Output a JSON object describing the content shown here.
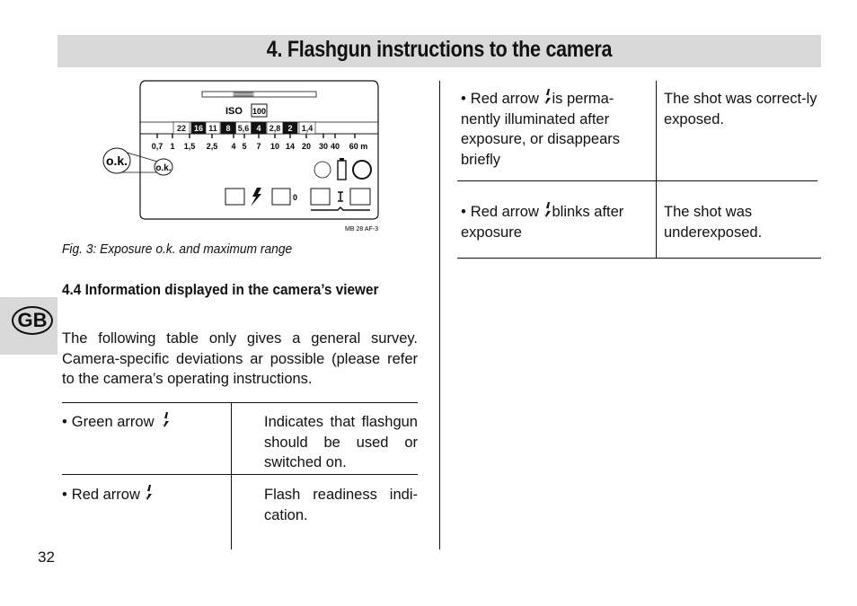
{
  "header": {
    "title": "4. Flashgun instructions to the camera"
  },
  "language_tab": {
    "label": "GB"
  },
  "figure": {
    "caption": "Fig. 3: Exposure o.k. and maximum range",
    "iso_label": "ISO",
    "iso_value": "100",
    "apertures": [
      {
        "value": "22",
        "inverted": false
      },
      {
        "value": "16",
        "inverted": true
      },
      {
        "value": "11",
        "inverted": false
      },
      {
        "value": "8",
        "inverted": true
      },
      {
        "value": "5,6",
        "inverted": false
      },
      {
        "value": "4",
        "inverted": true
      },
      {
        "value": "2,8",
        "inverted": false
      },
      {
        "value": "2",
        "inverted": true
      },
      {
        "value": "1,4",
        "inverted": false
      }
    ],
    "distances": [
      "0,7",
      "1",
      "1,5",
      "2,5",
      "4",
      "5",
      "7",
      "10",
      "14",
      "20",
      "30",
      "40",
      "60 m"
    ],
    "ok_label": "o.k.",
    "ok_zoom_label": "o.k.",
    "zero_label": "0",
    "model_code": "MB 28 AF-3"
  },
  "section": {
    "heading": "4.4 Information displayed in the camera’s viewer",
    "intro": "The following table only gives a general survey. Camera-specific deviations ar possible (please refer to the camera’s operating instructions."
  },
  "table_left": [
    {
      "signal_prefix": "Green arrow",
      "signal_suffix": "",
      "icon": "flash-arrow-icon",
      "meaning": "Indicates that flashgun should be used or switched on."
    },
    {
      "signal_prefix": "Red arrow",
      "signal_suffix": "",
      "icon": "flash-arrow-icon",
      "meaning": "Flash readiness indi-cation."
    }
  ],
  "table_right": [
    {
      "signal_prefix": "Red arrow",
      "signal_suffix": "is perma-nently illuminated after exposure, or disappears briefly",
      "icon": "flash-arrow-icon",
      "meaning": "The shot was correct-ly exposed."
    },
    {
      "signal_prefix": "Red arrow",
      "signal_suffix": "blinks after exposure",
      "icon": "flash-arrow-icon",
      "meaning": "The shot was underexposed."
    }
  ],
  "bullet": "•",
  "page_number": "32"
}
